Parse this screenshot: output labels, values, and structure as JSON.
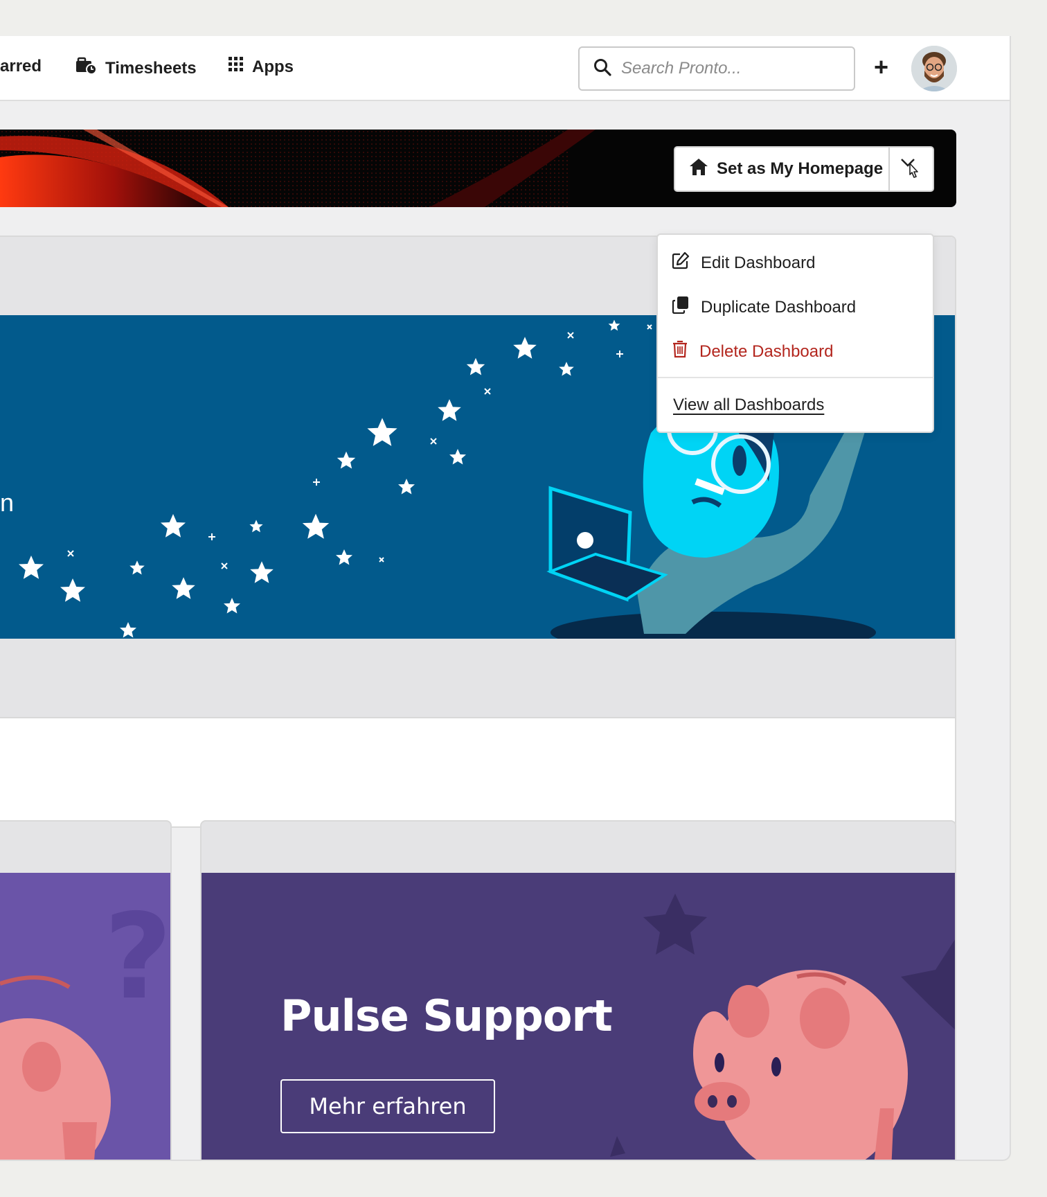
{
  "nav": {
    "starred_label": "arred",
    "timesheets_label": "Timesheets",
    "apps_label": "Apps"
  },
  "search": {
    "placeholder": "Search Pronto..."
  },
  "header": {
    "add_label": "+"
  },
  "dashboard": {
    "homepage_button_label": "Set as My Homepage",
    "banner_text_fragment": "n"
  },
  "menu": {
    "edit_label": "Edit Dashboard",
    "duplicate_label": "Duplicate Dashboard",
    "delete_label": "Delete Dashboard",
    "view_all_label": "View all Dashboards"
  },
  "promo": {
    "title": "Pulse Support",
    "button_label": "Mehr erfahren"
  },
  "colors": {
    "banner_blue": "#025a8c",
    "promo_purple": "#4a3c78",
    "danger": "#b3261e"
  }
}
